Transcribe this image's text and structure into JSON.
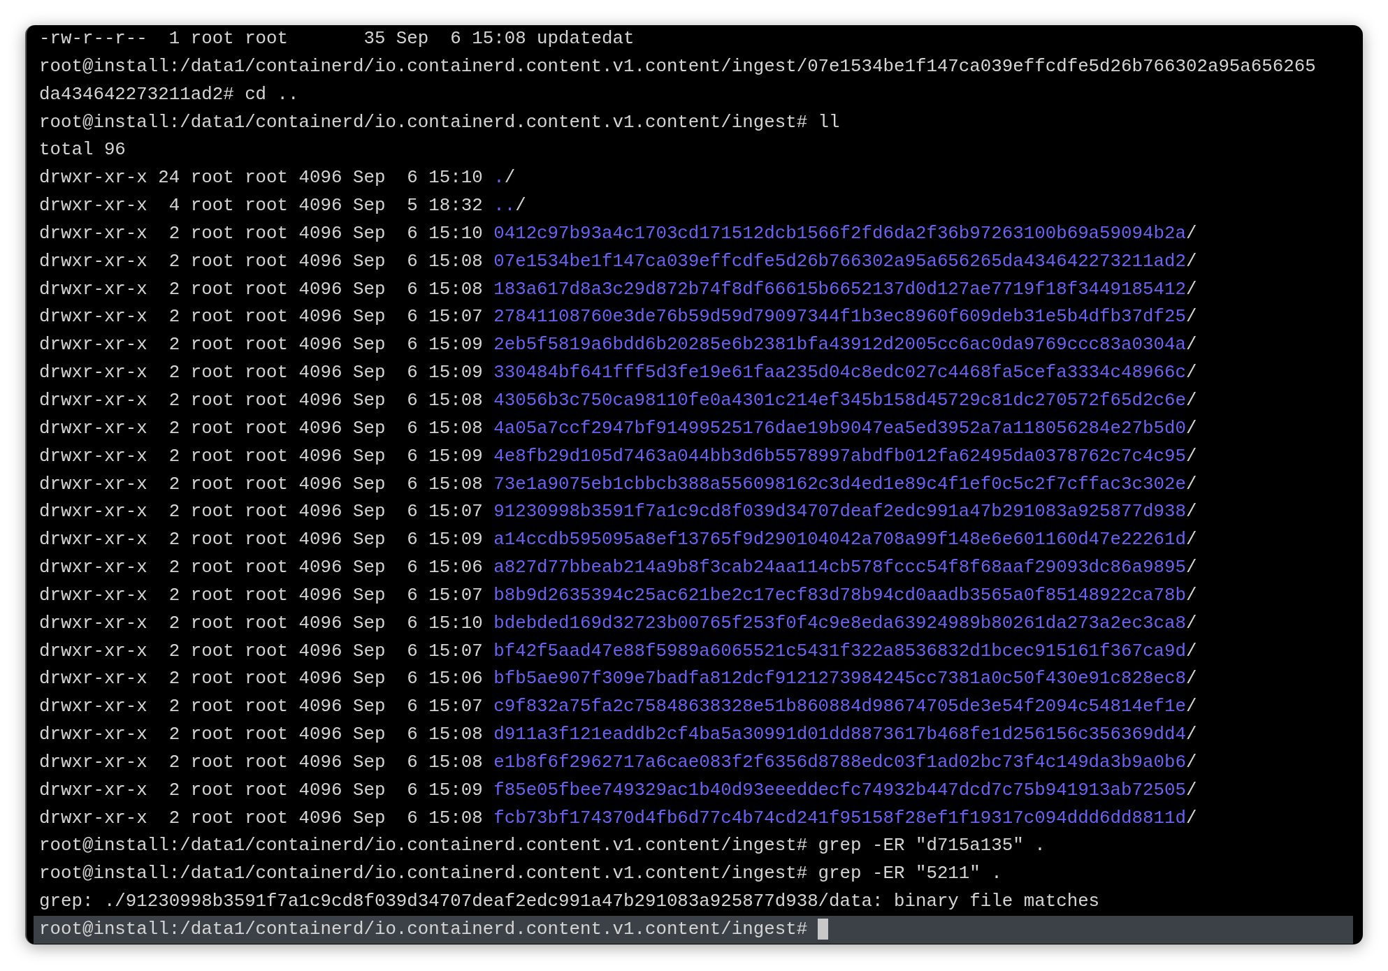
{
  "lines": [
    {
      "kind": "text",
      "text": "-rw-r--r--  1 root root       35 Sep  6 15:08 updatedat"
    },
    {
      "kind": "text",
      "text": "root@install:/data1/containerd/io.containerd.content.v1.content/ingest/07e1534be1f147ca039effcdfe5d26b766302a95a656265"
    },
    {
      "kind": "text",
      "text": "da434642273211ad2# cd .."
    },
    {
      "kind": "text",
      "text": "root@install:/data1/containerd/io.containerd.content.v1.content/ingest# ll"
    },
    {
      "kind": "text",
      "text": "total 96"
    },
    {
      "kind": "entry",
      "meta": "drwxr-xr-x 24 root root 4096 Sep  6 15:10",
      "name": ".",
      "suffix": "/"
    },
    {
      "kind": "entry",
      "meta": "drwxr-xr-x  4 root root 4096 Sep  5 18:32",
      "name": "..",
      "suffix": "/"
    },
    {
      "kind": "entry",
      "meta": "drwxr-xr-x  2 root root 4096 Sep  6 15:10",
      "name": "0412c97b93a4c1703cd171512dcb1566f2fd6da2f36b97263100b69a59094b2a",
      "suffix": "/"
    },
    {
      "kind": "entry",
      "meta": "drwxr-xr-x  2 root root 4096 Sep  6 15:08",
      "name": "07e1534be1f147ca039effcdfe5d26b766302a95a656265da434642273211ad2",
      "suffix": "/"
    },
    {
      "kind": "entry",
      "meta": "drwxr-xr-x  2 root root 4096 Sep  6 15:08",
      "name": "183a617d8a3c29d872b74f8df66615b6652137d0d127ae7719f18f3449185412",
      "suffix": "/"
    },
    {
      "kind": "entry",
      "meta": "drwxr-xr-x  2 root root 4096 Sep  6 15:07",
      "name": "27841108760e3de76b59d59d79097344f1b3ec8960f609deb31e5b4dfb37df25",
      "suffix": "/"
    },
    {
      "kind": "entry",
      "meta": "drwxr-xr-x  2 root root 4096 Sep  6 15:09",
      "name": "2eb5f5819a6bdd6b20285e6b2381bfa43912d2005cc6ac0da9769ccc83a0304a",
      "suffix": "/"
    },
    {
      "kind": "entry",
      "meta": "drwxr-xr-x  2 root root 4096 Sep  6 15:09",
      "name": "330484bf641fff5d3fe19e61faa235d04c8edc027c4468fa5cefa3334c48966c",
      "suffix": "/"
    },
    {
      "kind": "entry",
      "meta": "drwxr-xr-x  2 root root 4096 Sep  6 15:08",
      "name": "43056b3c750ca98110fe0a4301c214ef345b158d45729c81dc270572f65d2c6e",
      "suffix": "/"
    },
    {
      "kind": "entry",
      "meta": "drwxr-xr-x  2 root root 4096 Sep  6 15:08",
      "name": "4a05a7ccf2947bf91499525176dae19b9047ea5ed3952a7a118056284e27b5d0",
      "suffix": "/"
    },
    {
      "kind": "entry",
      "meta": "drwxr-xr-x  2 root root 4096 Sep  6 15:09",
      "name": "4e8fb29d105d7463a044bb3d6b5578997abdfb012fa62495da0378762c7c4c95",
      "suffix": "/"
    },
    {
      "kind": "entry",
      "meta": "drwxr-xr-x  2 root root 4096 Sep  6 15:08",
      "name": "73e1a9075eb1cbbcb388a556098162c3d4ed1e89c4f1ef0c5c2f7cffac3c302e",
      "suffix": "/"
    },
    {
      "kind": "entry",
      "meta": "drwxr-xr-x  2 root root 4096 Sep  6 15:07",
      "name": "91230998b3591f7a1c9cd8f039d34707deaf2edc991a47b291083a925877d938",
      "suffix": "/"
    },
    {
      "kind": "entry",
      "meta": "drwxr-xr-x  2 root root 4096 Sep  6 15:09",
      "name": "a14ccdb595095a8ef13765f9d290104042a708a99f148e6e601160d47e22261d",
      "suffix": "/"
    },
    {
      "kind": "entry",
      "meta": "drwxr-xr-x  2 root root 4096 Sep  6 15:06",
      "name": "a827d77bbeab214a9b8f3cab24aa114cb578fccc54f8f68aaf29093dc86a9895",
      "suffix": "/"
    },
    {
      "kind": "entry",
      "meta": "drwxr-xr-x  2 root root 4096 Sep  6 15:07",
      "name": "b8b9d2635394c25ac621be2c17ecf83d78b94cd0aadb3565a0f85148922ca78b",
      "suffix": "/"
    },
    {
      "kind": "entry",
      "meta": "drwxr-xr-x  2 root root 4096 Sep  6 15:10",
      "name": "bdebded169d32723b00765f253f0f4c9e8eda63924989b80261da273a2ec3ca8",
      "suffix": "/"
    },
    {
      "kind": "entry",
      "meta": "drwxr-xr-x  2 root root 4096 Sep  6 15:07",
      "name": "bf42f5aad47e88f5989a6065521c5431f322a8536832d1bcec915161f367ca9d",
      "suffix": "/"
    },
    {
      "kind": "entry",
      "meta": "drwxr-xr-x  2 root root 4096 Sep  6 15:06",
      "name": "bfb5ae907f309e7badfa812dcf9121273984245cc7381a0c50f430e91c828ec8",
      "suffix": "/"
    },
    {
      "kind": "entry",
      "meta": "drwxr-xr-x  2 root root 4096 Sep  6 15:07",
      "name": "c9f832a75fa2c75848638328e51b860884d98674705de3e54f2094c54814ef1e",
      "suffix": "/"
    },
    {
      "kind": "entry",
      "meta": "drwxr-xr-x  2 root root 4096 Sep  6 15:08",
      "name": "d911a3f121eaddb2cf4ba5a30991d01dd8873617b468fe1d256156c356369dd4",
      "suffix": "/"
    },
    {
      "kind": "entry",
      "meta": "drwxr-xr-x  2 root root 4096 Sep  6 15:08",
      "name": "e1b8f6f2962717a6cae083f2f6356d8788edc03f1ad02bc73f4c149da3b9a0b6",
      "suffix": "/"
    },
    {
      "kind": "entry",
      "meta": "drwxr-xr-x  2 root root 4096 Sep  6 15:09",
      "name": "f85e05fbee749329ac1b40d93eeeddecfc74932b447dcd7c75b941913ab72505",
      "suffix": "/"
    },
    {
      "kind": "entry",
      "meta": "drwxr-xr-x  2 root root 4096 Sep  6 15:08",
      "name": "fcb73bf174370d4fb6d77c4b74cd241f95158f28ef1f19317c094ddd6dd8811d",
      "suffix": "/"
    },
    {
      "kind": "text",
      "text": "root@install:/data1/containerd/io.containerd.content.v1.content/ingest# grep -ER \"d715a135\" ."
    },
    {
      "kind": "text",
      "text": "root@install:/data1/containerd/io.containerd.content.v1.content/ingest# grep -ER \"5211\" ."
    },
    {
      "kind": "text",
      "text": "grep: ./91230998b3591f7a1c9cd8f039d34707deaf2edc991a47b291083a925877d938/data: binary file matches"
    },
    {
      "kind": "prompt",
      "text": "root@install:/data1/containerd/io.containerd.content.v1.content/ingest#"
    }
  ]
}
